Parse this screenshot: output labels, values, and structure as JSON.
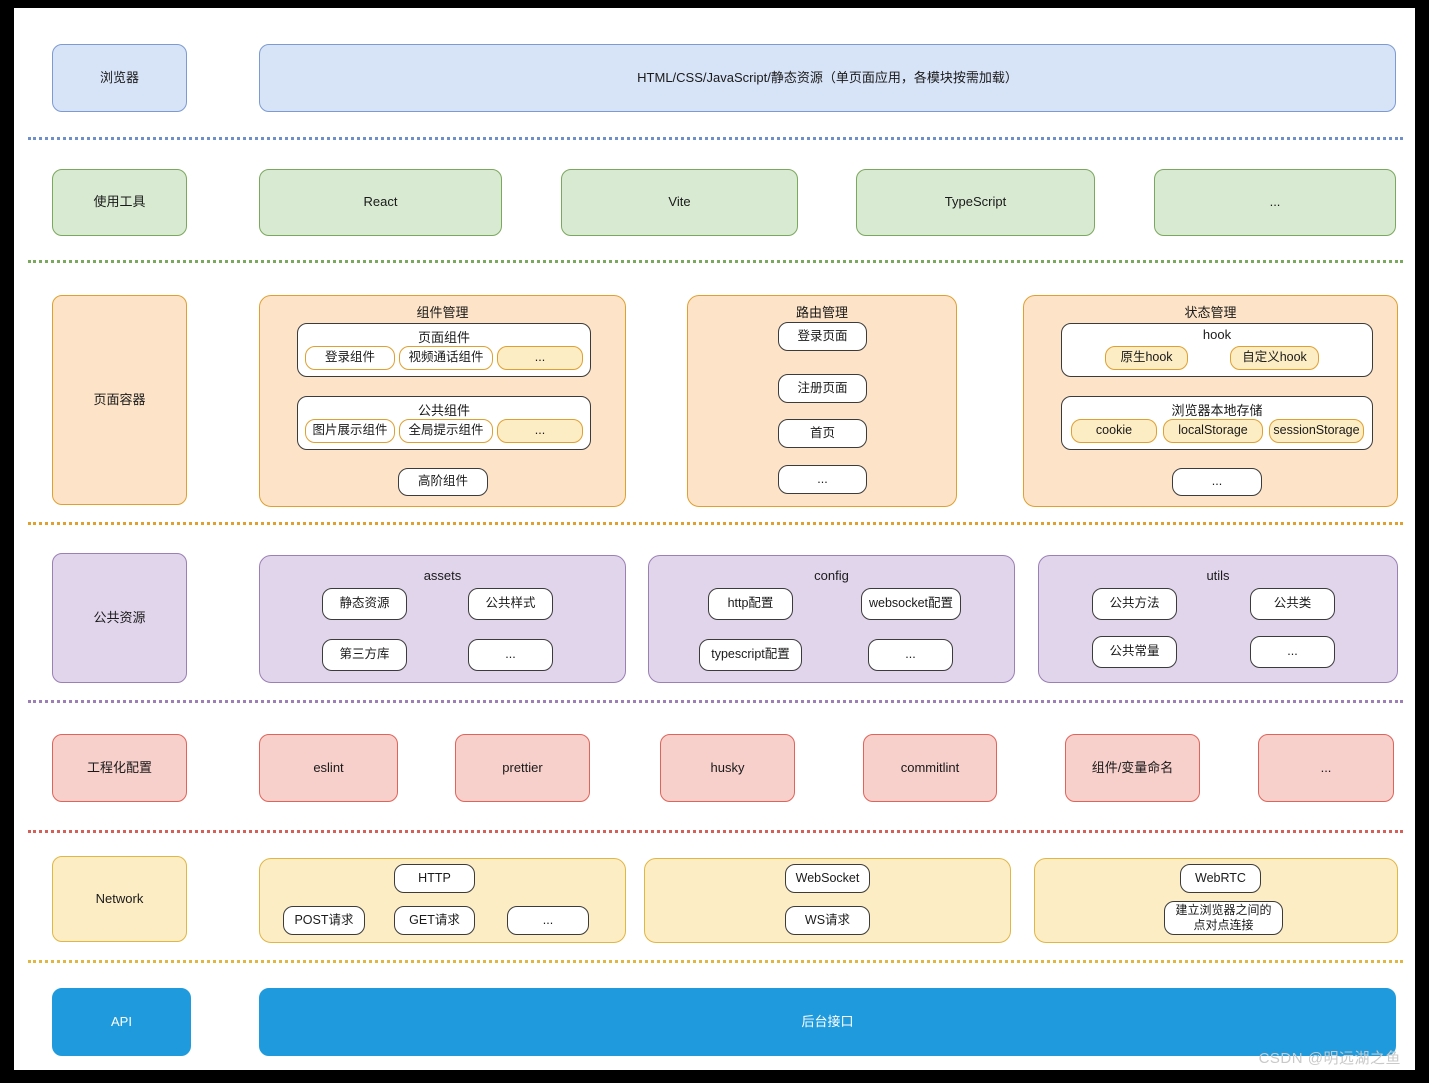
{
  "meta": {
    "watermark": "CSDN @明远湖之鱼"
  },
  "colors": {
    "browser": "#d7e3f7",
    "tools": "#d9ead3",
    "page_container": "#fde4c8",
    "public_resource": "#e1d5ec",
    "engineering": "#f7cfcb",
    "network": "#fdedc4",
    "api": "#1f9bdd"
  },
  "layers": {
    "browser": {
      "label": "浏览器",
      "banner": "HTML/CSS/JavaScript/静态资源（单页面应用，各模块按需加载）"
    },
    "tools": {
      "label": "使用工具",
      "items": [
        "React",
        "Vite",
        "TypeScript",
        "..."
      ]
    },
    "page_container": {
      "label": "页面容器",
      "groups": [
        {
          "title": "组件管理",
          "subgroups": [
            {
              "title": "页面组件",
              "items": [
                "登录组件",
                "视频通话组件",
                "..."
              ]
            },
            {
              "title": "公共组件",
              "items": [
                "图片展示组件",
                "全局提示组件",
                "..."
              ]
            }
          ],
          "extra": [
            "高阶组件"
          ]
        },
        {
          "title": "路由管理",
          "items": [
            "登录页面",
            "注册页面",
            "首页",
            "..."
          ]
        },
        {
          "title": "状态管理",
          "subgroups": [
            {
              "title": "hook",
              "items": [
                "原生hook",
                "自定义hook"
              ]
            },
            {
              "title": "浏览器本地存储",
              "items": [
                "cookie",
                "localStorage",
                "sessionStorage"
              ]
            }
          ],
          "extra": [
            "..."
          ]
        }
      ]
    },
    "public_resource": {
      "label": "公共资源",
      "groups": [
        {
          "title": "assets",
          "items": [
            "静态资源",
            "公共样式",
            "第三方库",
            "..."
          ]
        },
        {
          "title": "config",
          "items": [
            "http配置",
            "websocket配置",
            "typescript配置",
            "..."
          ]
        },
        {
          "title": "utils",
          "items": [
            "公共方法",
            "公共类",
            "公共常量",
            "..."
          ]
        }
      ]
    },
    "engineering": {
      "label": "工程化配置",
      "items": [
        "eslint",
        "prettier",
        "husky",
        "commitlint",
        "组件/变量命名",
        "..."
      ]
    },
    "network": {
      "label": "Network",
      "groups": [
        {
          "head": "HTTP",
          "items": [
            "POST请求",
            "GET请求",
            "..."
          ]
        },
        {
          "head": "WebSocket",
          "items": [
            "WS请求"
          ]
        },
        {
          "head": "WebRTC",
          "items": [
            "建立浏览器之间的\n点对点连接"
          ]
        }
      ]
    },
    "api": {
      "label": "API",
      "banner": "后台接口"
    }
  }
}
